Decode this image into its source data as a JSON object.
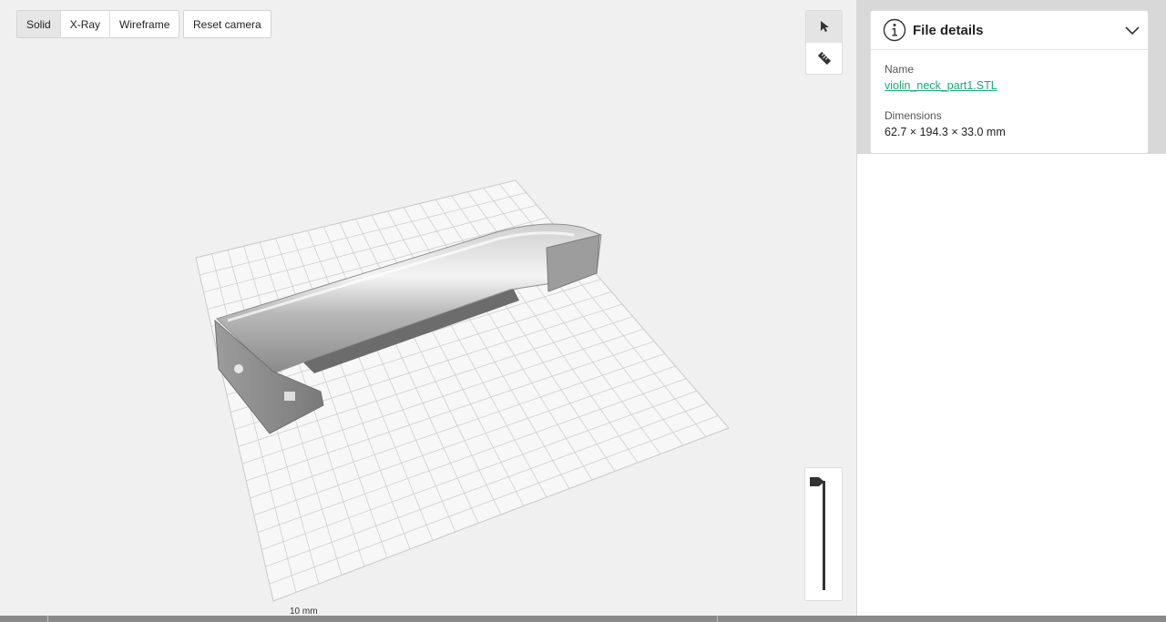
{
  "toolbar": {
    "view_modes": [
      {
        "label": "Solid",
        "active": true
      },
      {
        "label": "X-Ray",
        "active": false
      },
      {
        "label": "Wireframe",
        "active": false
      }
    ],
    "reset_camera": "Reset camera"
  },
  "tools": [
    {
      "icon": "pointer-icon",
      "active": true
    },
    {
      "icon": "ruler-icon",
      "active": false
    }
  ],
  "scale_label": "10 mm",
  "file_details": {
    "title": "File details",
    "name_label": "Name",
    "name_value": "violin_neck_part1.STL",
    "dimensions_label": "Dimensions",
    "dimensions_value": "62.7 × 194.3 × 33.0 mm"
  },
  "colors": {
    "link": "#1aa879",
    "viewport_bg": "#f0f0f0"
  }
}
